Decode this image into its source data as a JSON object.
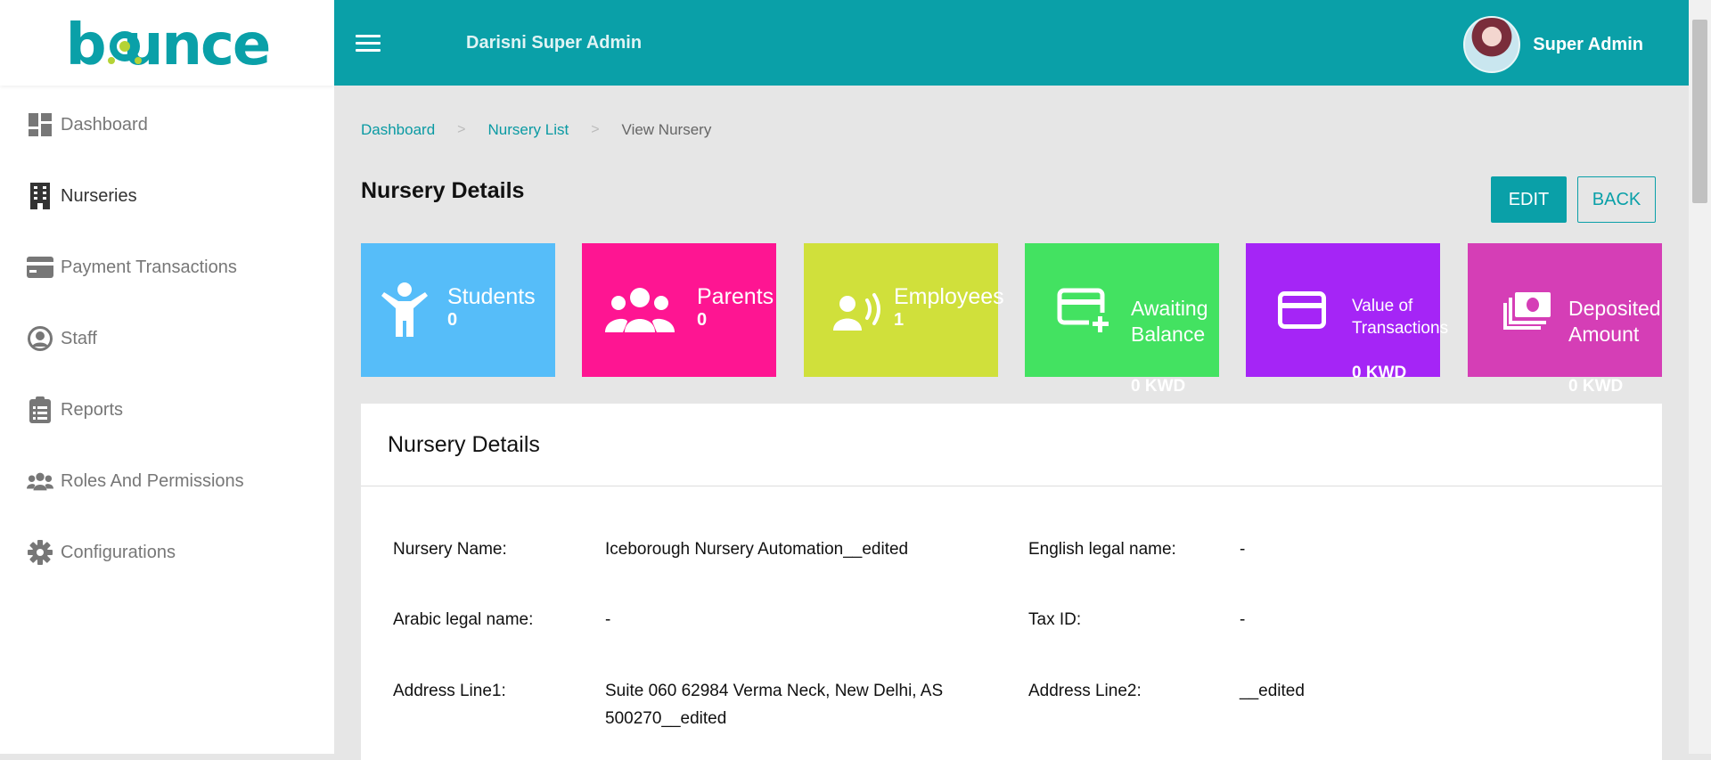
{
  "brand": {
    "logo_text": "bounce",
    "color": "#0aa0a8",
    "accent": "#b5d335"
  },
  "sidebar": {
    "items": [
      {
        "label": "Dashboard",
        "icon": "dashboard-icon",
        "active": false
      },
      {
        "label": "Nurseries",
        "icon": "building-icon",
        "active": true
      },
      {
        "label": "Payment Transactions",
        "icon": "credit-card-icon",
        "active": false
      },
      {
        "label": "Staff",
        "icon": "user-circle-icon",
        "active": false
      },
      {
        "label": "Reports",
        "icon": "clipboard-icon",
        "active": false
      },
      {
        "label": "Roles And Permissions",
        "icon": "users-icon",
        "active": false
      },
      {
        "label": "Configurations",
        "icon": "gear-icon",
        "active": false
      }
    ]
  },
  "header": {
    "title": "Darisni Super Admin",
    "user_name": "Super Admin",
    "background": "#0aa0a8"
  },
  "breadcrumb": [
    "Dashboard",
    "Nursery List",
    "View Nursery"
  ],
  "page": {
    "title": "Nursery Details",
    "edit_label": "EDIT",
    "back_label": "BACK"
  },
  "cards": [
    {
      "label": "Students",
      "value": "0",
      "color": "#56bdf9",
      "icon": "child-icon"
    },
    {
      "label": "Parents",
      "value": "0",
      "color": "#fe1592",
      "icon": "group-icon"
    },
    {
      "label": "Employees",
      "value": "1",
      "color": "#d0e03b",
      "icon": "speaker-icon"
    },
    {
      "label": "Awaiting\nBalance",
      "value": "0 KWD",
      "color": "#43e261",
      "icon": "card-plus-icon"
    },
    {
      "label": "Value of\nTransactions",
      "value": "0 KWD",
      "color": "#a525f6",
      "icon": "credit-card-icon"
    },
    {
      "label": "Deposited\nAmount",
      "value": "0 KWD",
      "color": "#d53eb6",
      "icon": "money-icon"
    }
  ],
  "details": {
    "panel_title": "Nursery Details",
    "fields": [
      {
        "label": "Nursery Name:",
        "value": "Iceborough Nursery Automation__edited"
      },
      {
        "label": "English legal name:",
        "value": "-"
      },
      {
        "label": "Arabic legal name:",
        "value": "-"
      },
      {
        "label": "Tax ID:",
        "value": "-"
      },
      {
        "label": "Address Line1:",
        "value": "Suite 060 62984 Verma Neck, New Delhi, AS 500270__edited"
      },
      {
        "label": "Address Line2:",
        "value": "__edited"
      }
    ]
  }
}
